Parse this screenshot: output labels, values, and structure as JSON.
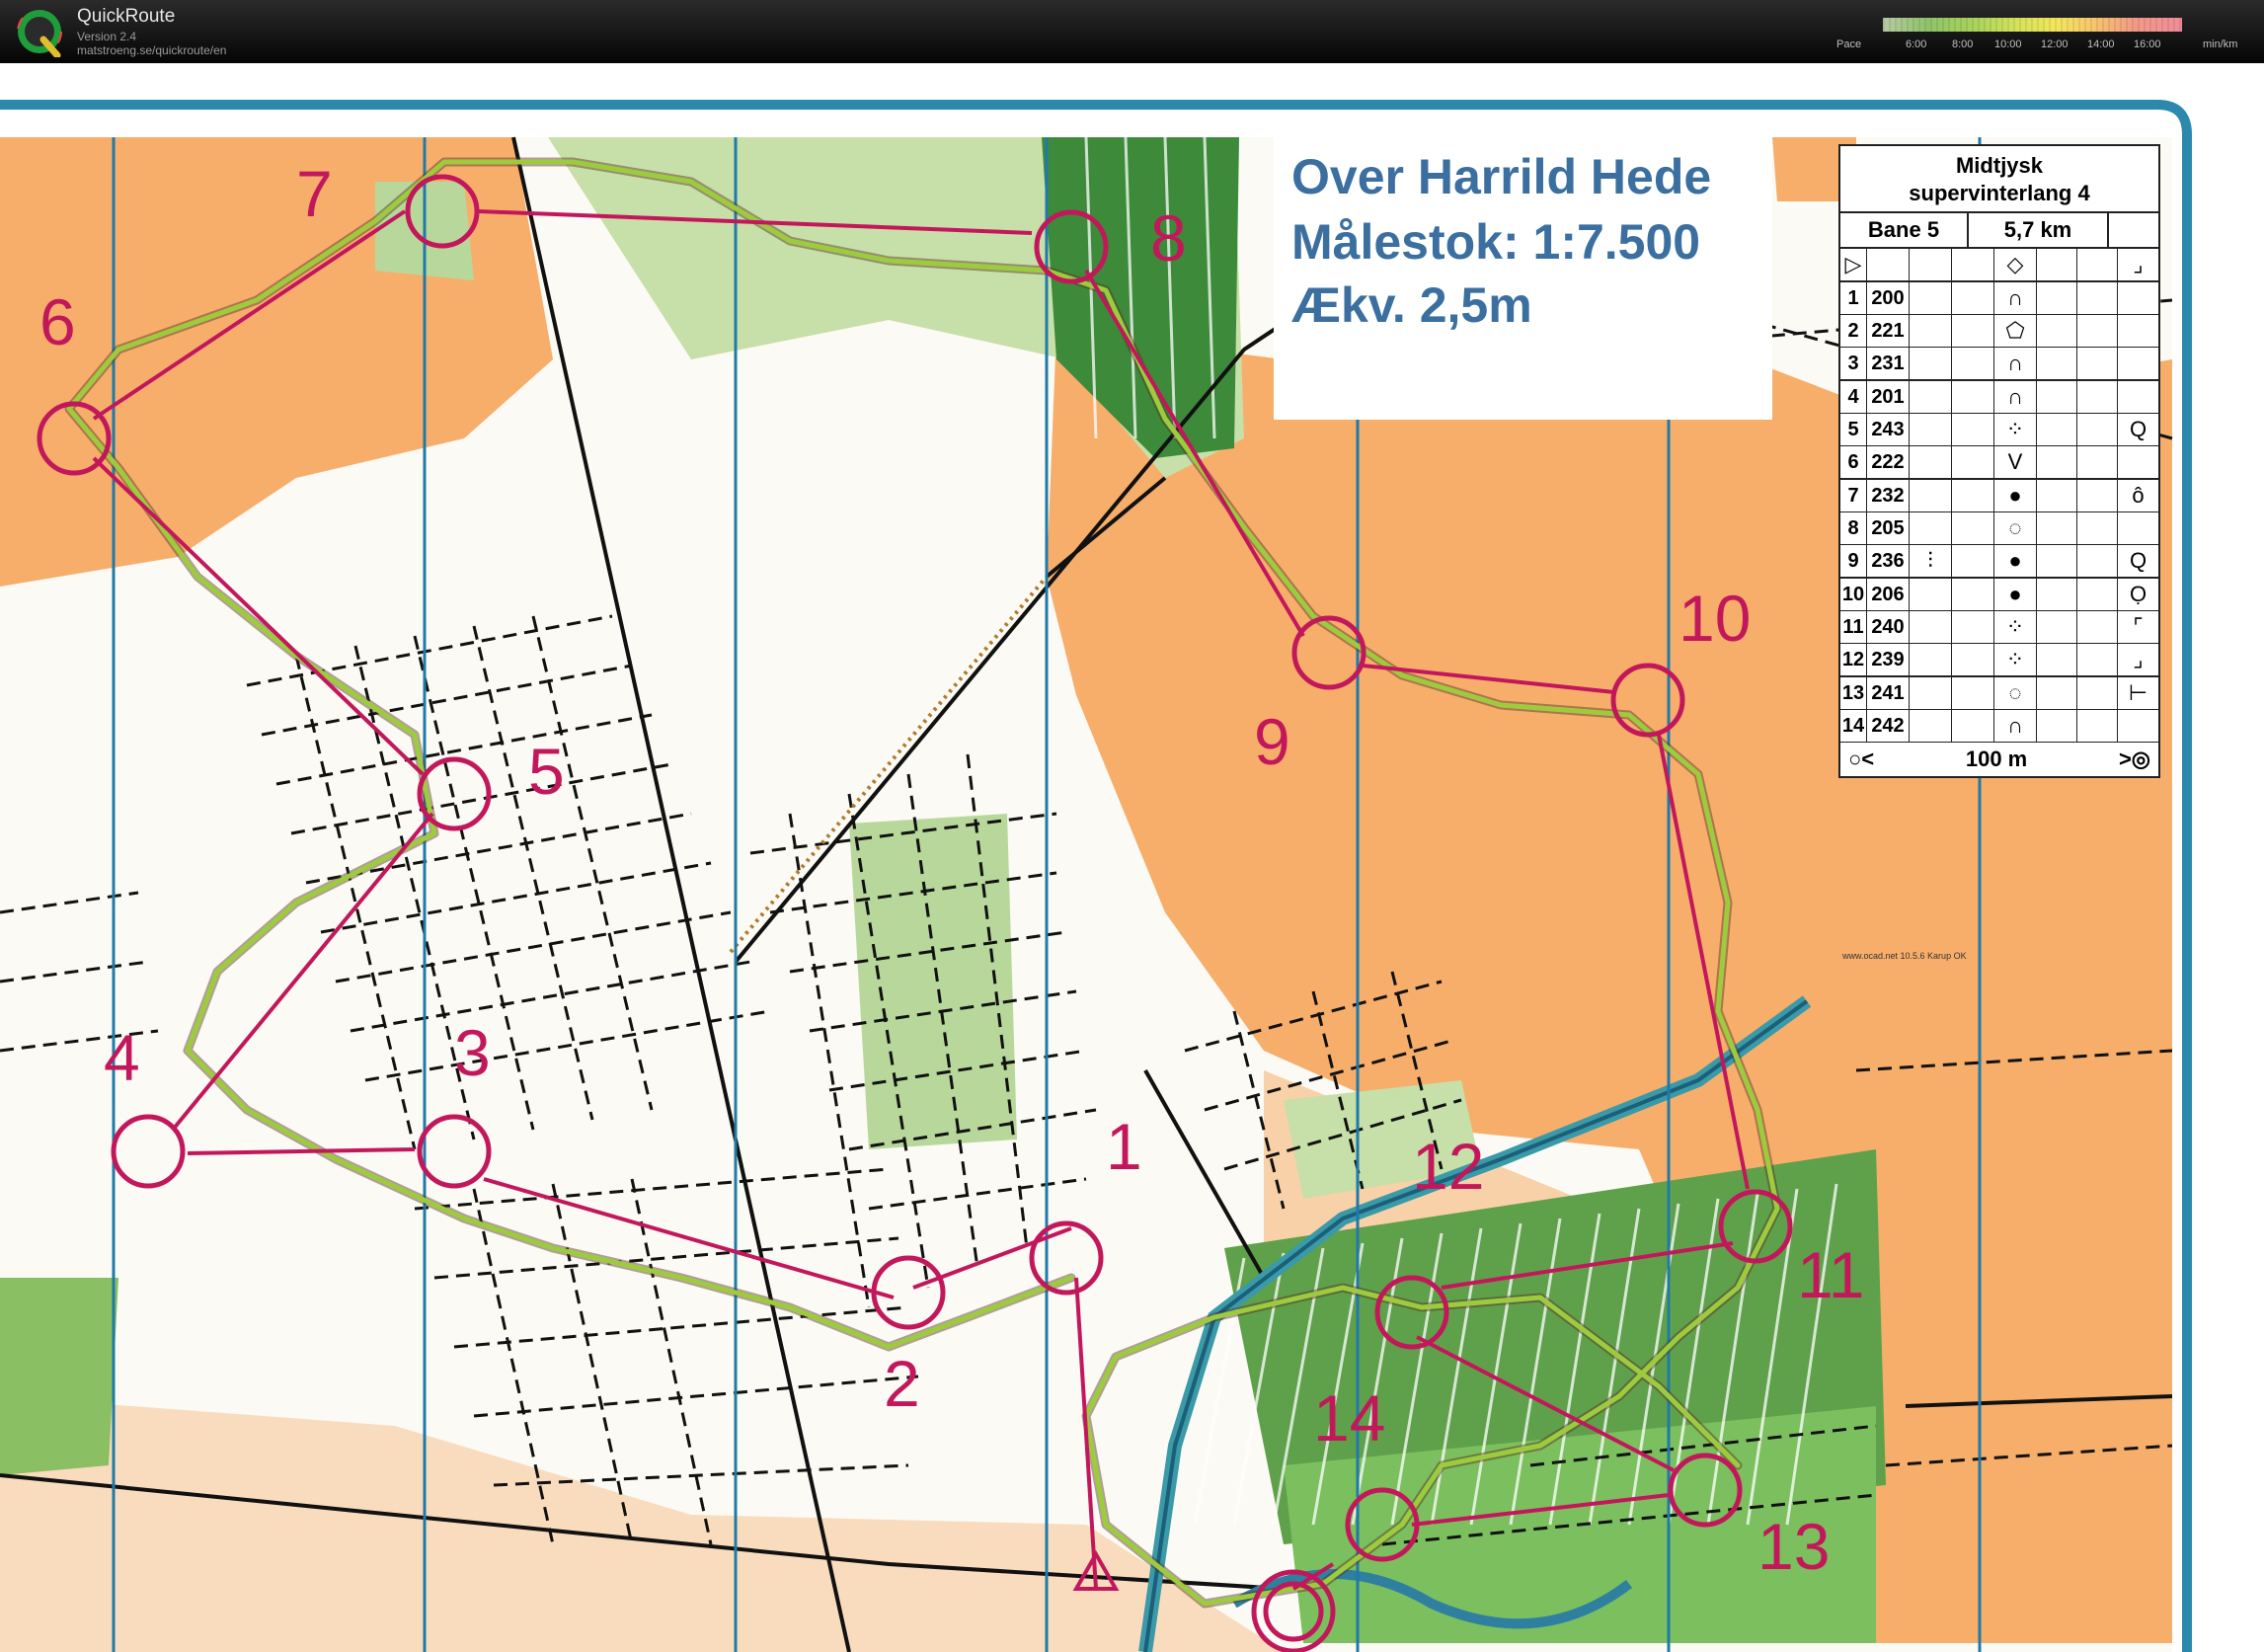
{
  "app": {
    "title": "QuickRoute",
    "version": "Version 2.4",
    "url": "matstroeng.se/quickroute/en",
    "logo_letter": "Q"
  },
  "pace_legend": {
    "label": "Pace",
    "ticks": [
      "6:00",
      "8:00",
      "10:00",
      "12:00",
      "14:00",
      "16:00"
    ],
    "unit": "min/km"
  },
  "map": {
    "title_lines": [
      "Over Harrild Hede",
      "Målestok: 1:7.500",
      "Ækv. 2,5m"
    ],
    "control_numbers": [
      "1",
      "2",
      "3",
      "4",
      "5",
      "6",
      "7",
      "8",
      "9",
      "10",
      "11",
      "12",
      "13",
      "14"
    ],
    "credit": "www.ocad.net 10.5.6 Karup OK",
    "colors": {
      "open_land": "#f7ae6b",
      "forest_green": "#6fa84a",
      "course_magenta": "#c2185b",
      "north_lines": "#1f7aa8",
      "route": "#8ab83a"
    }
  },
  "description": {
    "event_line1": "Midtjysk",
    "event_line2": "supervinterlang 4",
    "course": "Bane 5",
    "length": "5,7 km",
    "rows": [
      {
        "n": "1",
        "code": "200",
        "f": "",
        "sym": "∩",
        "g": ""
      },
      {
        "n": "2",
        "code": "221",
        "f": "",
        "sym": "⬠",
        "g": ""
      },
      {
        "n": "3",
        "code": "231",
        "f": "",
        "sym": "∩",
        "g": ""
      },
      {
        "n": "4",
        "code": "201",
        "f": "",
        "sym": "∩",
        "g": ""
      },
      {
        "n": "5",
        "code": "243",
        "f": "",
        "sym": "⁘",
        "g": "Q"
      },
      {
        "n": "6",
        "code": "222",
        "f": "",
        "sym": "V",
        "g": ""
      },
      {
        "n": "7",
        "code": "232",
        "f": "",
        "sym": "●",
        "g": "ô"
      },
      {
        "n": "8",
        "code": "205",
        "f": "",
        "sym": "◌",
        "g": ""
      },
      {
        "n": "9",
        "code": "236",
        "f": "⫶",
        "sym": "●",
        "g": "Q"
      },
      {
        "n": "10",
        "code": "206",
        "f": "",
        "sym": "●",
        "g": "Ọ"
      },
      {
        "n": "11",
        "code": "240",
        "f": "",
        "sym": "⁘",
        "g": "⌜"
      },
      {
        "n": "12",
        "code": "239",
        "f": "",
        "sym": "⁘",
        "g": "⌟"
      },
      {
        "n": "13",
        "code": "241",
        "f": "",
        "sym": "◌",
        "g": "⊢"
      },
      {
        "n": "14",
        "code": "242",
        "f": "",
        "sym": "∩",
        "g": ""
      }
    ],
    "footer_left": "○<",
    "footer_mid": "100 m",
    "footer_right": ">◎"
  }
}
